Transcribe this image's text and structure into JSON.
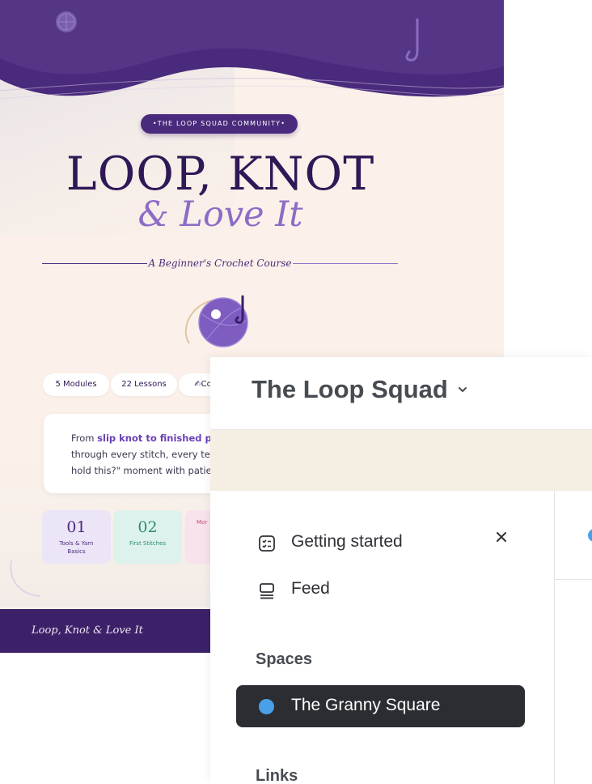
{
  "course_page": {
    "community_badge": "•THE LOOP SQUAD COMMUNITY•",
    "title_line1": "LOOP, KNOT",
    "title_line2": "& Love It",
    "subtitle": "A Beginner's Crochet Course",
    "stats": [
      "5 Modules",
      "22 Lessons",
      "✍Co"
    ],
    "intro": {
      "line1_pre": "From ",
      "line1_bold": "slip knot to finished proj",
      "line2": "through every stitch, every tec",
      "line3": "hold this?\" moment with patie"
    },
    "modules": [
      {
        "number": "01",
        "label": "Tools & Yarn Basics"
      },
      {
        "number": "02",
        "label": "First Stitches"
      },
      {
        "number": "",
        "label": "Mor"
      }
    ],
    "footer_text": "Loop, Knot & Love It",
    "colors": {
      "brand_purple": "#4a2a7c",
      "lavender": "#8d6cc6",
      "cream": "#fbf1ea"
    }
  },
  "community_app": {
    "workspace_name": "The Loop Squad",
    "nav": {
      "getting_started": "Getting started",
      "feed": "Feed"
    },
    "spaces_heading": "Spaces",
    "spaces": [
      {
        "label": "The Granny Square",
        "color": "#4aa0e8"
      }
    ],
    "links_heading": "Links"
  }
}
